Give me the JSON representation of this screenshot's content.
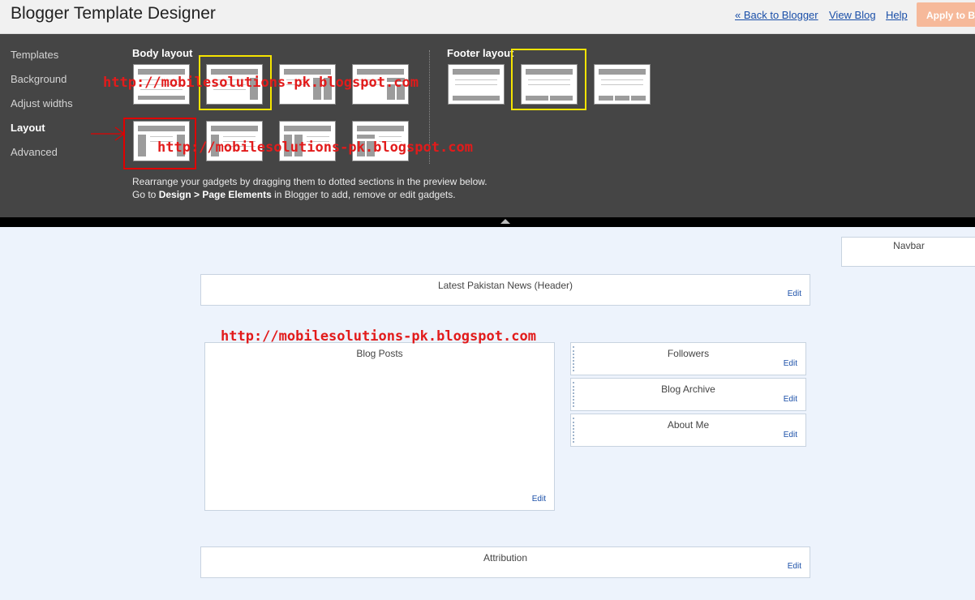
{
  "header": {
    "title": "Blogger Template Designer",
    "links": {
      "back": "« Back to Blogger",
      "view_blog": "View Blog",
      "help": "Help"
    },
    "apply_label": "Apply to Blog"
  },
  "sidebar": {
    "items": [
      {
        "label": "Templates"
      },
      {
        "label": "Background"
      },
      {
        "label": "Adjust widths"
      },
      {
        "label": "Layout",
        "active": true
      },
      {
        "label": "Advanced"
      }
    ]
  },
  "layout": {
    "body_label": "Body layout",
    "footer_label": "Footer layout",
    "instructions": {
      "line1": "Rearrange your gadgets by dragging them to dotted sections in the preview below.",
      "line2_prefix": "Go to ",
      "line2_bold": "Design > Page Elements",
      "line2_suffix": " in Blogger to add, remove or edit gadgets."
    }
  },
  "watermark": {
    "text": "http://mobilesolutions-pk.blogspot.com"
  },
  "preview": {
    "navbar": "Navbar",
    "header_gadget": "Latest Pakistan News (Header)",
    "blog_posts": "Blog Posts",
    "sidebar_gadgets": [
      "Followers",
      "Blog Archive",
      "About Me"
    ],
    "attribution": "Attribution",
    "edit_label": "Edit"
  },
  "colors": {
    "panel_bg": "#454545",
    "selected_outline": "#f5e400",
    "annotation_red": "#e00000",
    "link_blue": "#1a4fa8",
    "preview_bg": "#edf3fc"
  }
}
